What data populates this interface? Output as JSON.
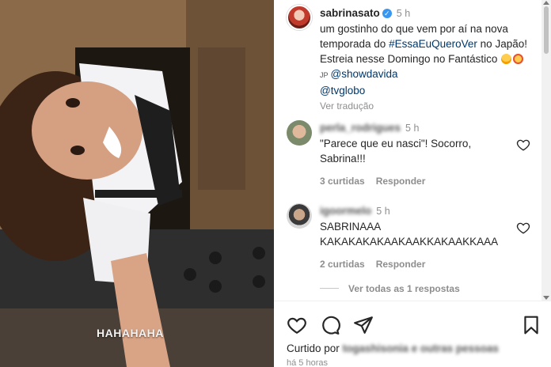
{
  "media": {
    "overlay_text": "HAHAHAHA"
  },
  "post": {
    "username": "sabrinasato",
    "time": "5 h",
    "caption_line1": "um gostinho do que vem por aí na nova temporada do",
    "hashtag": "#EssaEuQueroVer",
    "caption_line2": "no Japão! Estreia nesse Domingo no Fantástico",
    "emoji_text": "JP",
    "mention1": "@showdavida",
    "mention2": "@tvglobo",
    "translate": "Ver tradução"
  },
  "comments": [
    {
      "username": "perla_rodrigues",
      "time": "5 h",
      "text": "\"Parece que eu nasci\"! Socorro, Sabrina!!!",
      "likes": "3 curtidas",
      "reply": "Responder"
    },
    {
      "username": "igoormelo",
      "time": "5 h",
      "text": "SABRINAAA KAKAKAKAKAAKAAKKAKAAKKAAA",
      "likes": "2 curtidas",
      "reply": "Responder"
    }
  ],
  "view_replies": "Ver todas as 1 respostas",
  "footer": {
    "liked_by_prefix": "Curtido por",
    "liked_by_rest": "togashisonia e outras pessoas",
    "ago": "há 5 horas"
  },
  "icons": [
    "heart-icon",
    "comment-icon",
    "share-icon",
    "bookmark-icon",
    "verified-icon"
  ],
  "colors": {
    "link": "#00376b",
    "muted": "#8e8e8e",
    "verified": "#3897f0"
  }
}
